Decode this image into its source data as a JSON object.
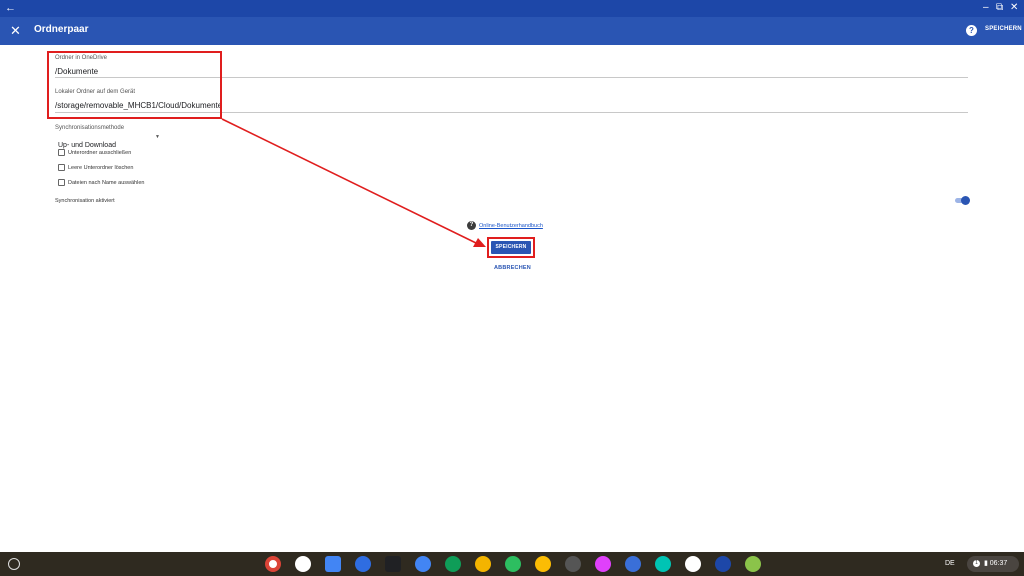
{
  "titlebar": {
    "back_icon": "arrow-left-icon",
    "win_icons": [
      "minimize-icon",
      "restore-icon",
      "close-icon"
    ]
  },
  "appbar": {
    "title": "Ordnerpaar",
    "save_label": "SPEICHERN",
    "help_icon": "?"
  },
  "form": {
    "onedrive_folder": {
      "label": "Ordner in OneDrive",
      "value": "/Dokumente"
    },
    "local_folder": {
      "label": "Lokaler Ordner auf dem Gerät",
      "value": "/storage/removable_MHCB1/Cloud/Dokumente"
    },
    "sync_method": {
      "label": "Synchronisationsmethode",
      "value": "Up- und Download"
    },
    "checkboxes": [
      {
        "label": "Unterordner ausschließen",
        "checked": false
      },
      {
        "label": "Leere Unterordner löschen",
        "checked": false
      },
      {
        "label": "Dateien nach Name auswählen",
        "checked": false
      }
    ],
    "sync_enabled": {
      "label": "Synchronisation aktiviert",
      "on": true
    },
    "help_link": "Online-Benutzerhandbuch",
    "save_label": "SPEICHERN",
    "cancel_label": "ABBRECHEN"
  },
  "shelf": {
    "apps": [
      "chrome-icon",
      "gmail-icon",
      "calendar-icon",
      "files-icon",
      "terminal-icon",
      "docs-icon",
      "sheets-icon",
      "slides-icon",
      "evernote-icon",
      "keep-icon",
      "app-icon",
      "app-icon",
      "app-icon",
      "app-icon",
      "play-store-icon",
      "cloud-sync-icon",
      "app-icon"
    ],
    "language": "DE",
    "time": "06:37"
  },
  "colors": {
    "accent": "#2a55b3",
    "titlebar": "#1d47a8",
    "highlight": "#e01e1e",
    "shelf": "#2f2a20"
  }
}
